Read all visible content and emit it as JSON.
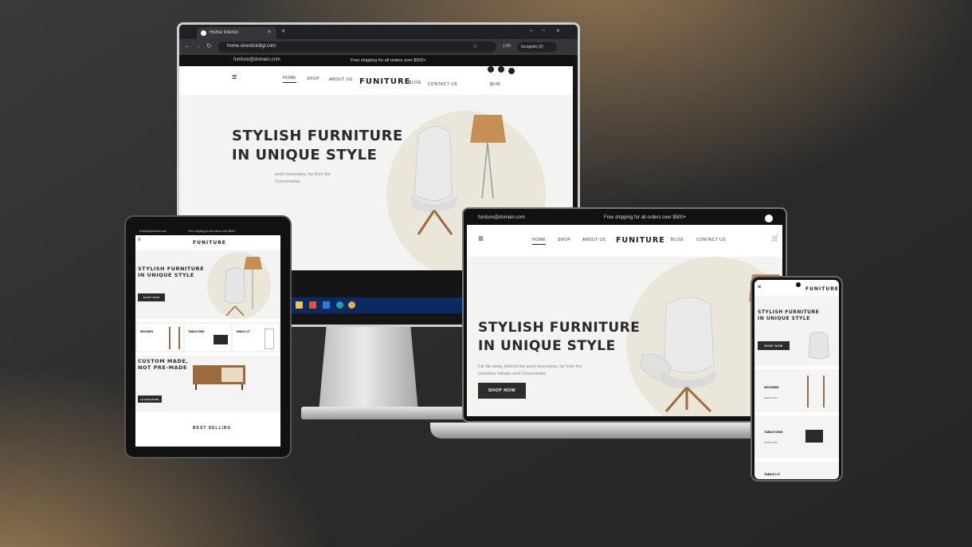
{
  "browser": {
    "tab_title": "Home Interior",
    "url": "home.onestickdigi.com",
    "profile": "Incognito (2)",
    "zoom": "1:00"
  },
  "site": {
    "email": "funiture@domain.com",
    "topbar_notice": "Free shipping for all orders over $500+",
    "brand": "FUNITURE",
    "nav": [
      "HOME",
      "SHOP",
      "ABOUT US",
      "BLOG",
      "CONTACT US"
    ],
    "cart_total": "$0.00",
    "hero_line1": "STYLISH FURNITURE",
    "hero_line2": "IN UNIQUE STYLE",
    "hero_desc": "Far far away, behind the word mountains, far from the countries Vokalia and Consonantia",
    "hero_desc_partial": "word mountains, far from the\nConsonantia",
    "shop_now": "SHOP NOW",
    "categories": [
      {
        "name": "WOODEN",
        "cta": "SHOP NOW"
      },
      {
        "name": "TABLE DISK",
        "cta": "SHOP NOW"
      },
      {
        "name": "TABLE LIT",
        "cta": "SHOP NOW"
      }
    ],
    "custom_made_line1": "CUSTOM MADE,",
    "custom_made_line2": "NOT PRE-MADE",
    "learn_more": "LEARN MORE",
    "best_selling": "BEST SELLING"
  },
  "colors": {
    "accent": "#2c2c2c",
    "hero_bg": "#f3f3f1",
    "circle": "#ebe6da",
    "lamp_shade": "#c58f55",
    "wood": "#9c6a3e"
  },
  "icons": {
    "menu": "hamburger-icon",
    "cart": "cart-icon",
    "social": [
      "pinterest-icon",
      "twitter-icon",
      "instagram-icon"
    ]
  }
}
